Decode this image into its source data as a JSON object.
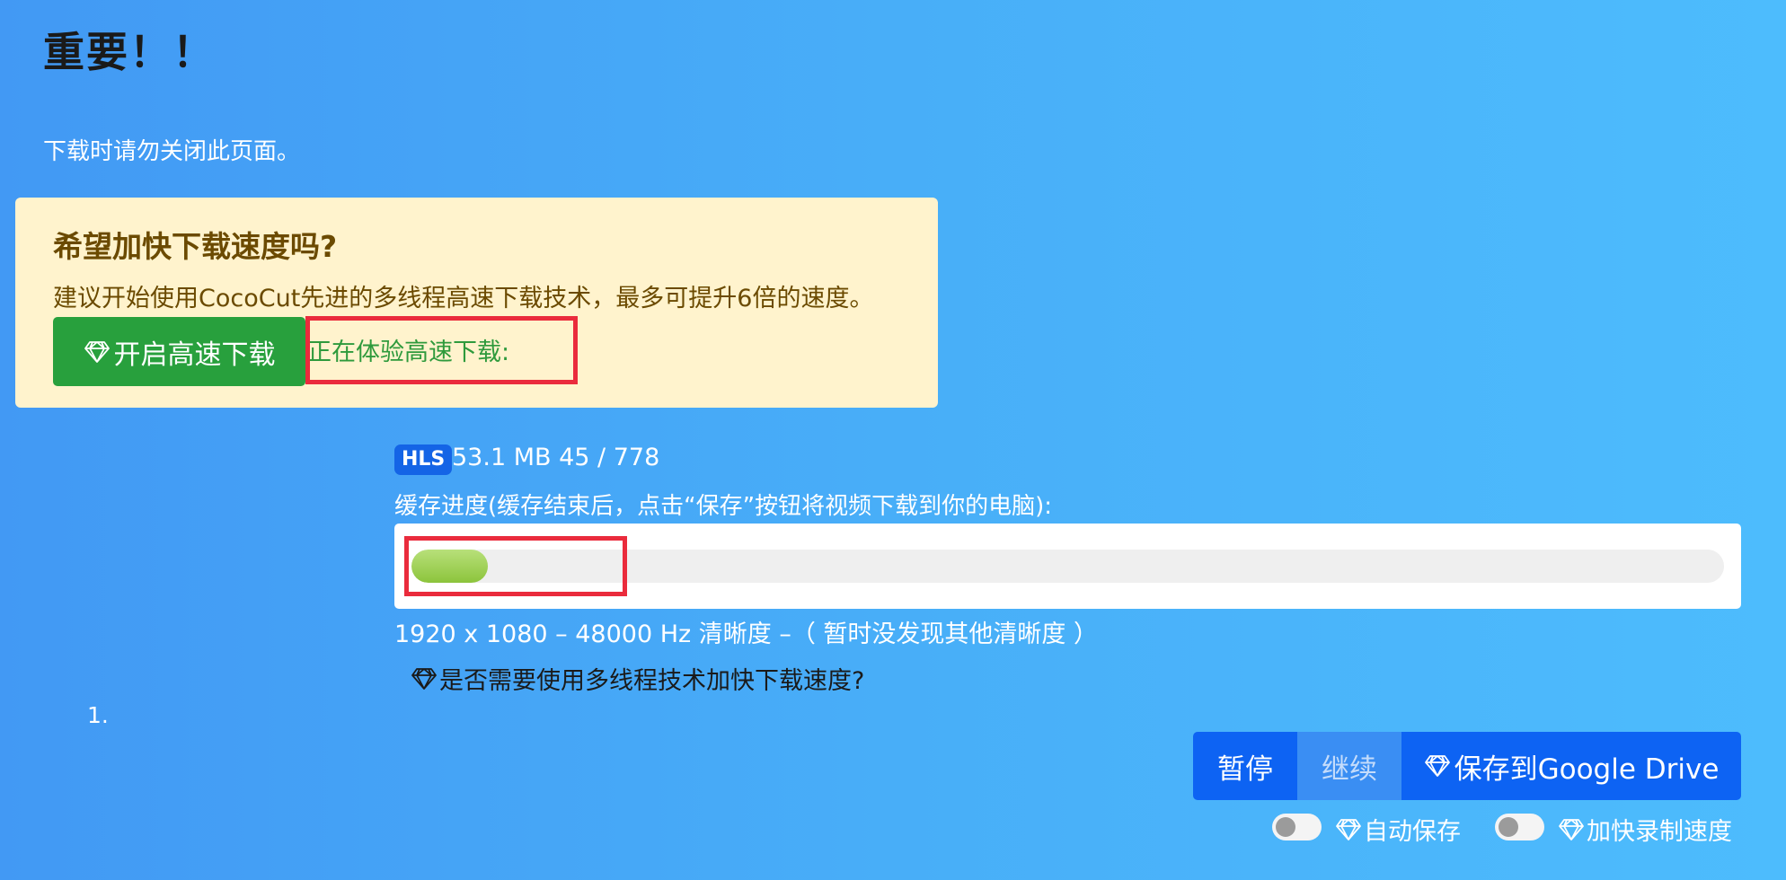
{
  "page": {
    "title": "重要！！",
    "notice": "下载时请勿关闭此页面。"
  },
  "promo": {
    "heading": "希望加快下载速度吗?",
    "text": "建议开始使用CocoCut先进的多线程高速下载技术，最多可提升6倍的速度。",
    "button_label": "开启高速下载",
    "status": "正在体验高速下载:",
    "button_icon": "diamond-icon"
  },
  "download": {
    "badge": "HLS",
    "size_info": "53.1 MB 45 / 778",
    "cache_label": "缓存进度(缓存结束后，点击“保存”按钮将视频下载到你的电脑):",
    "progress_fraction": 0.058,
    "resolution_info": "1920 x 1080 – 48000 Hz 清晰度 –（ 暂时没发现其他清晰度 ）",
    "multithread_question": "是否需要使用多线程技术加快下载速度?",
    "list_number": "1."
  },
  "actions": {
    "pause_label": "暂停",
    "resume_label": "继续",
    "save_label": "保存到Google Drive"
  },
  "toggles": {
    "auto_save_label": "自动保存",
    "speed_up_label": "加快录制速度",
    "auto_save_on": false,
    "speed_up_on": false
  },
  "colors": {
    "highlight_box": "#ea2b3c",
    "primary_button": "#0d63f3",
    "fast_button": "#28a03d",
    "promo_background": "#fff3cd",
    "progress_fill": "#9ccf4e"
  }
}
